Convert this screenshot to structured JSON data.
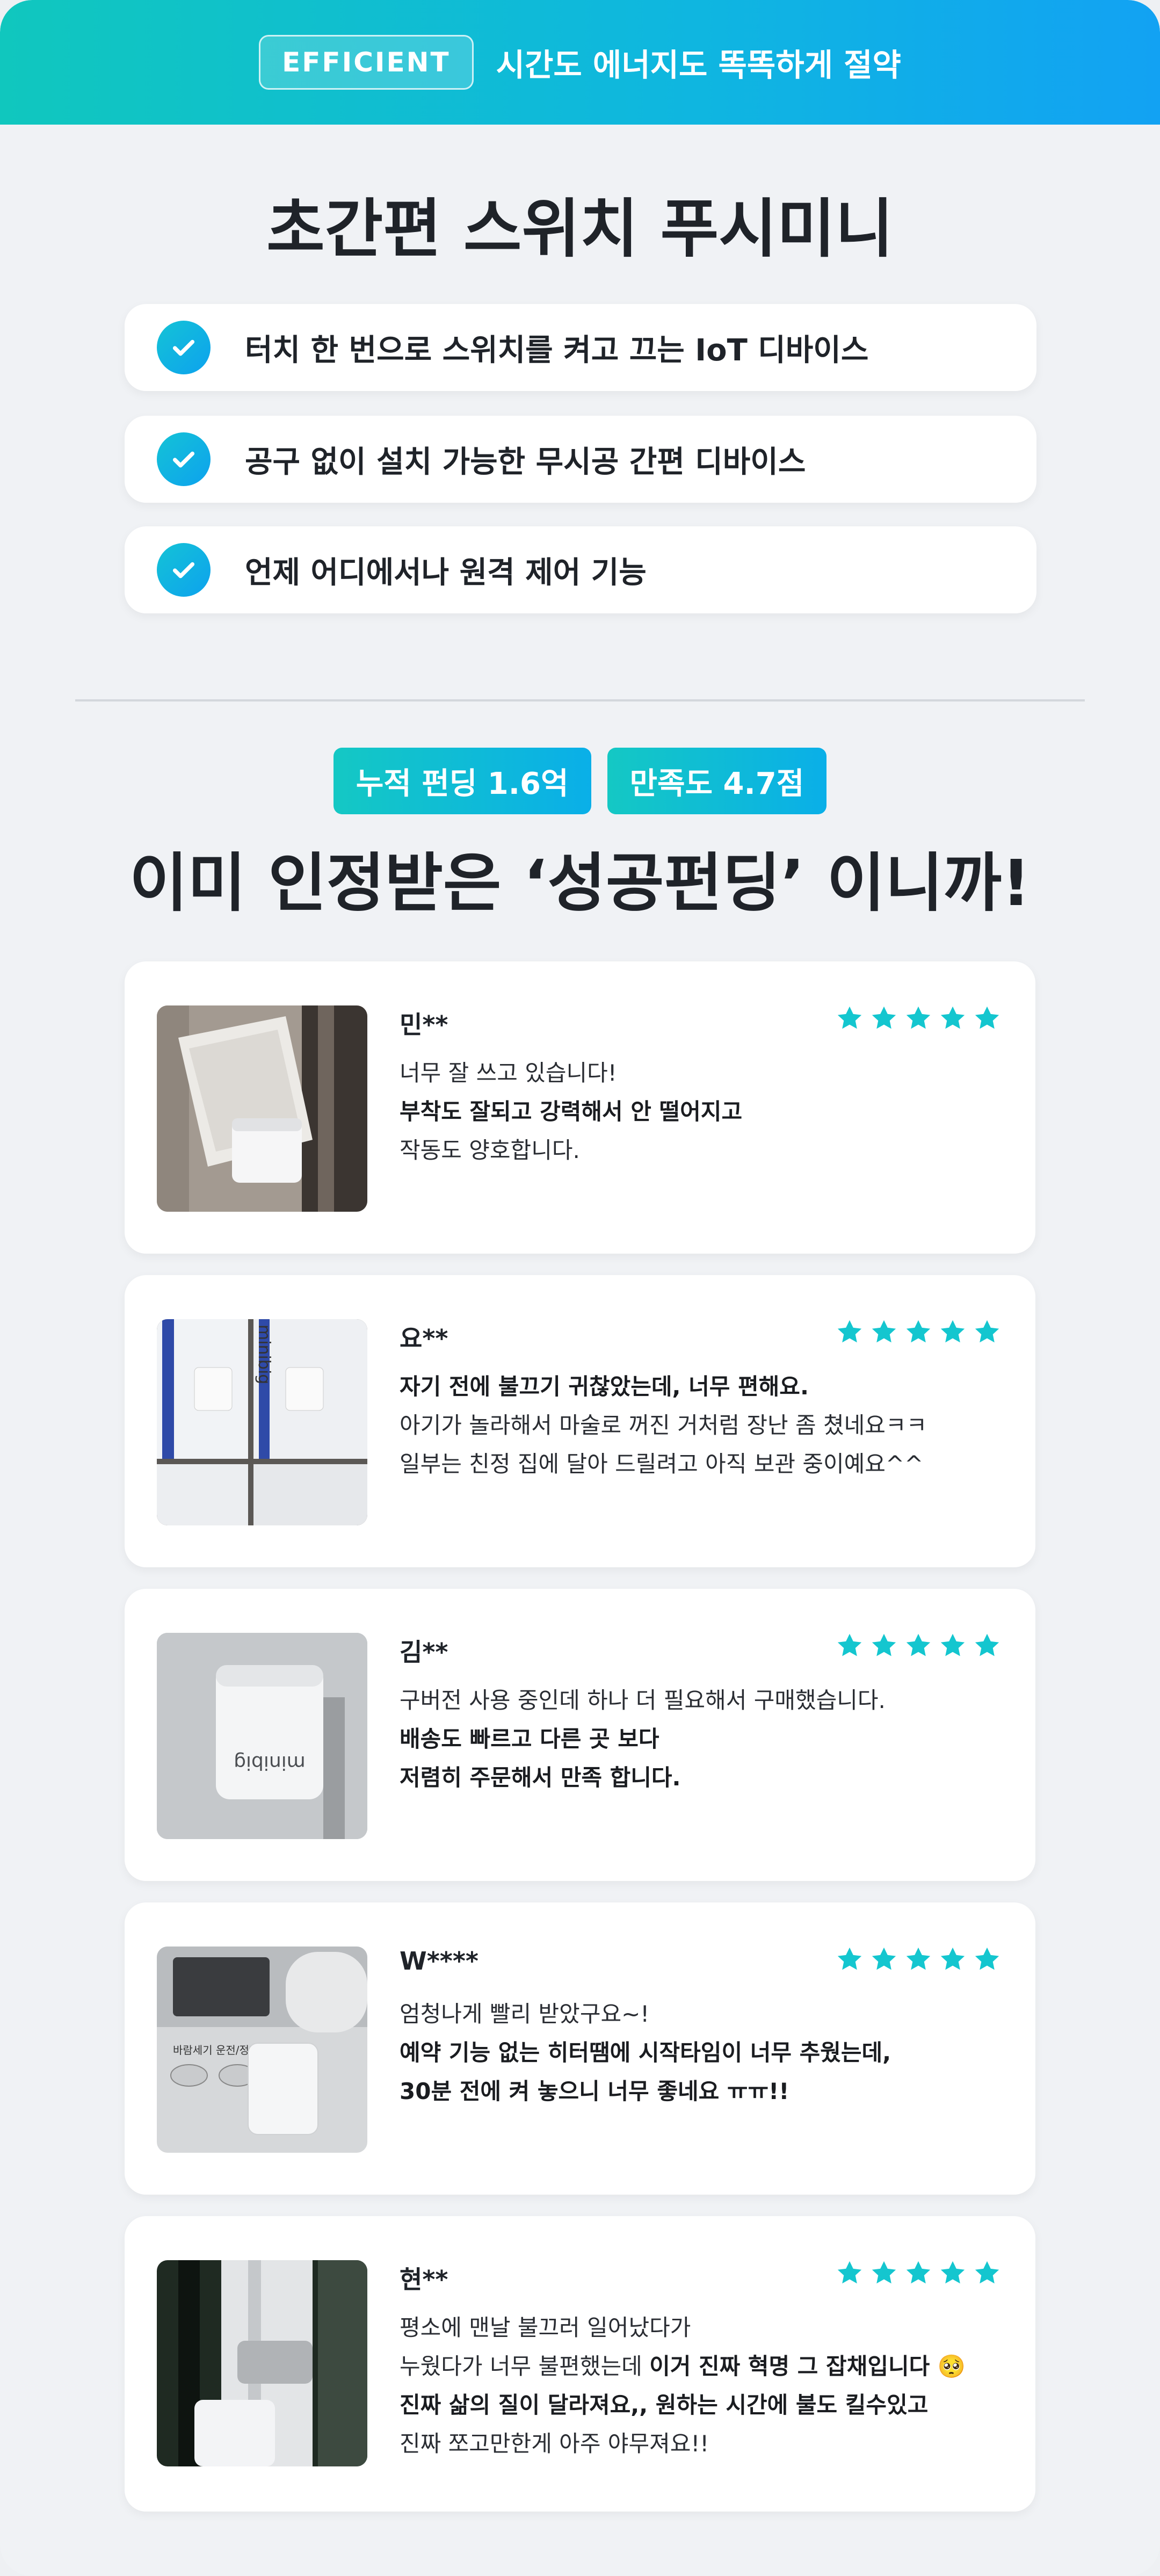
{
  "banner": {
    "pill_label": "EFFICIENT",
    "tagline": "시간도 에너지도 똑똑하게 절약"
  },
  "product": {
    "title": "초간편 스위치 푸시미니",
    "features": [
      "터치 한 번으로 스위치를 켜고 끄는 IoT 디바이스",
      "공구 없이 설치 가능한 무시공 간편 디바이스",
      "언제 어디에서나 원격 제어 기능"
    ]
  },
  "stats": {
    "funding_badge": "누적 펀딩 1.6억",
    "rating_badge": "만족도 4.7점",
    "headline": "이미 인정받은 ‘성공펀딩’ 이니까!"
  },
  "reviews": [
    {
      "name": "민**",
      "stars": 5,
      "lines": [
        {
          "text": "너무 잘 쓰고 있습니다!",
          "bold": false
        },
        {
          "text": "부착도 잘되고 강력해서 안 떨어지고",
          "bold": true
        },
        {
          "text": "작동도 양호합니다.",
          "bold": false
        }
      ]
    },
    {
      "name": "요**",
      "stars": 5,
      "lines": [
        {
          "text": "자기 전에 불끄기 귀찮았는데, 너무 편해요.",
          "bold": true
        },
        {
          "text": "아기가 놀라해서 마술로 꺼진 거처럼 장난 좀 쳤네요ㅋㅋ",
          "bold": false
        },
        {
          "text": "일부는 친정 집에 달아 드릴려고 아직 보관 중이예요^^",
          "bold": false
        }
      ]
    },
    {
      "name": "김**",
      "stars": 5,
      "lines": [
        {
          "text": "구버전 사용 중인데 하나 더 필요해서 구매했습니다.",
          "bold": false
        },
        {
          "text": "배송도 빠르고 다른 곳 보다",
          "bold": true
        },
        {
          "text": "저렴히 주문해서 만족 합니다.",
          "bold": true
        }
      ]
    },
    {
      "name": "W****",
      "stars": 5,
      "lines": [
        {
          "text": "엄청나게 빨리 받았구요~!",
          "bold": false
        },
        {
          "text": "예약 기능 없는 히터땜에 시작타임이 너무 추웠는데,",
          "bold": true
        },
        {
          "text": "30분 전에 켜 놓으니 너무 좋네요 ㅠㅠ!!",
          "bold": true
        }
      ]
    },
    {
      "name": "현**",
      "stars": 5,
      "lines": [
        {
          "text": "평소에 맨날 불끄러 일어났다가",
          "bold": false
        },
        {
          "text": "누웠다가 너무 불편했는데 ",
          "bold": false,
          "bold_tail": "이거 진짜 혁명 그 잡채입니다 🥺"
        },
        {
          "text": "진짜 삶의 질이 달라져요,, 원하는 시간에 불도 킬수있고",
          "bold": true
        },
        {
          "text": "진짜 쪼고만한게 아주 야무져요!!",
          "bold": false
        }
      ]
    }
  ],
  "photo_labels": {
    "box_brand": "minibig",
    "device_brand": "minibig",
    "heater_button_left": "바람세기",
    "heater_button_right": "운전/정지"
  },
  "colors": {
    "accent_teal": "#10c7be",
    "accent_blue": "#12a2f3",
    "star": "#14c6cf"
  }
}
